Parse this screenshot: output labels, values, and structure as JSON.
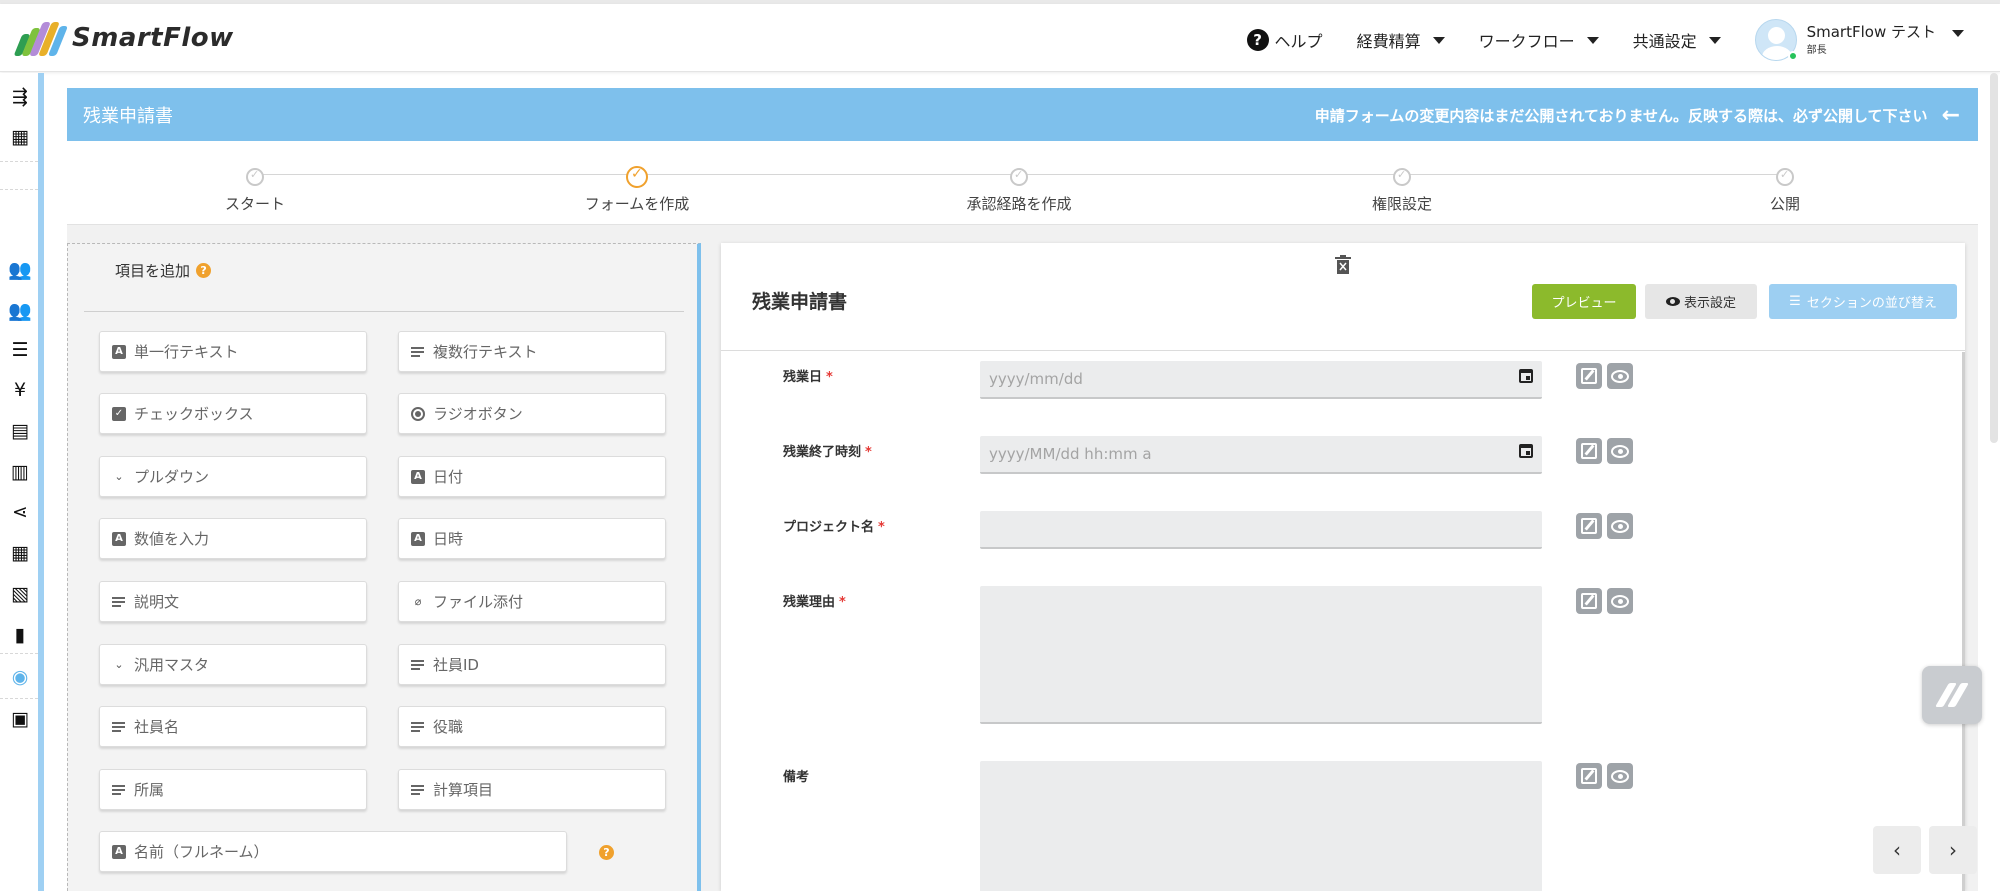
{
  "brand": {
    "name": "SmartFlow",
    "colors": [
      "#2e9e52",
      "#7ec23d",
      "#e8b02a",
      "#b38cd8",
      "#5fb4ea"
    ]
  },
  "header": {
    "help": "ヘルプ",
    "nav": [
      "経費精算",
      "ワークフロー",
      "共通設定"
    ],
    "user_name": "SmartFlow テスト",
    "user_role": "部長"
  },
  "rail_icons": [
    "menu-toggle-icon",
    "building-icon",
    "users-icon",
    "users-icon",
    "list-icon",
    "yen-icon",
    "ledger-icon",
    "receipt-icon",
    "share-icon",
    "table-icon",
    "library-icon",
    "document-icon",
    "palette-icon",
    "wallet-icon"
  ],
  "page": {
    "title": "残業申請書",
    "notice": "申請フォームの変更内容はまだ公開されておりません。反映する際は、必ず公開して下さい"
  },
  "steps": [
    {
      "label": "スタート",
      "active": false
    },
    {
      "label": "フォームを作成",
      "active": true
    },
    {
      "label": "承認経路を作成",
      "active": false
    },
    {
      "label": "権限設定",
      "active": false
    },
    {
      "label": "公開",
      "active": false
    }
  ],
  "palette": {
    "heading": "項目を追加",
    "items": [
      {
        "label": "単一行テキスト",
        "icon": "text-a-icon"
      },
      {
        "label": "複数行テキスト",
        "icon": "lines-icon"
      },
      {
        "label": "チェックボックス",
        "icon": "checkbox-icon"
      },
      {
        "label": "ラジオボタン",
        "icon": "radio-icon"
      },
      {
        "label": "プルダウン",
        "icon": "chevron-down-icon"
      },
      {
        "label": "日付",
        "icon": "text-a-icon"
      },
      {
        "label": "数値を入力",
        "icon": "text-a-icon"
      },
      {
        "label": "日時",
        "icon": "text-a-icon"
      },
      {
        "label": "説明文",
        "icon": "lines-icon"
      },
      {
        "label": "ファイル添付",
        "icon": "paperclip-icon"
      },
      {
        "label": "汎用マスタ",
        "icon": "chevron-down-icon"
      },
      {
        "label": "社員ID",
        "icon": "lines-icon"
      },
      {
        "label": "社員名",
        "icon": "lines-icon"
      },
      {
        "label": "役職",
        "icon": "lines-icon"
      },
      {
        "label": "所属",
        "icon": "lines-icon"
      },
      {
        "label": "計算項目",
        "icon": "lines-icon"
      },
      {
        "label": "名前（フルネーム）",
        "icon": "text-a-icon"
      }
    ]
  },
  "editor": {
    "title": "残業申請書",
    "preview": "プレビュー",
    "display_settings": "表示設定",
    "sort_sections": "セクションの並び替え",
    "fields": [
      {
        "label": "残業日",
        "required": "*",
        "placeholder": "yyyy/mm/dd",
        "type": "date"
      },
      {
        "label": "残業終了時刻",
        "required": "*",
        "placeholder": "yyyy/MM/dd hh:mm a",
        "type": "datetime"
      },
      {
        "label": "プロジェクト名",
        "required": "*",
        "placeholder": "",
        "type": "text"
      },
      {
        "label": "残業理由",
        "required": "*",
        "placeholder": "",
        "type": "textarea"
      },
      {
        "label": "備考",
        "required": "",
        "placeholder": "",
        "type": "textarea"
      }
    ]
  },
  "pager": {
    "prev": "‹",
    "next": "›"
  }
}
